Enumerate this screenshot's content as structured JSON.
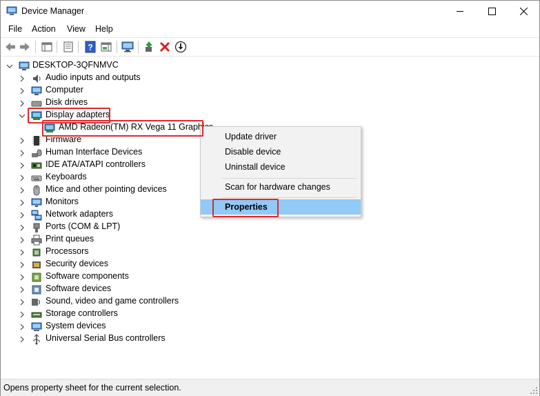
{
  "window": {
    "title": "Device Manager",
    "app_icon": "device-manager-icon",
    "controls": [
      "minimize-icon",
      "maximize-icon",
      "close-icon"
    ]
  },
  "menu": {
    "file": "File",
    "action": "Action",
    "view": "View",
    "help": "Help"
  },
  "toolbar": {
    "icons": [
      "back-icon",
      "forward-icon",
      "show-hide-console-tree-icon",
      "properties-icon",
      "help-icon",
      "action-pane-icon",
      "scan-hardware-icon",
      "update-driver-icon",
      "uninstall-icon",
      "disable-device-icon"
    ]
  },
  "tree": {
    "root": "DESKTOP-3QFNMVC",
    "items": [
      {
        "label": "Audio inputs and outputs",
        "icon": "speaker-icon"
      },
      {
        "label": "Computer",
        "icon": "computer-icon"
      },
      {
        "label": "Disk drives",
        "icon": "disk-drive-icon"
      },
      {
        "label": "Display adapters",
        "icon": "display-adapter-icon",
        "expanded": true,
        "children": [
          {
            "label": "AMD Radeon(TM) RX Vega 11 Graphics",
            "icon": "display-adapter-icon"
          }
        ]
      },
      {
        "label": "Firmware",
        "icon": "firmware-icon"
      },
      {
        "label": "Human Interface Devices",
        "icon": "hid-icon"
      },
      {
        "label": "IDE ATA/ATAPI controllers",
        "icon": "ide-controller-icon"
      },
      {
        "label": "Keyboards",
        "icon": "keyboard-icon"
      },
      {
        "label": "Mice and other pointing devices",
        "icon": "mouse-icon"
      },
      {
        "label": "Monitors",
        "icon": "monitor-icon"
      },
      {
        "label": "Network adapters",
        "icon": "network-adapter-icon"
      },
      {
        "label": "Ports (COM & LPT)",
        "icon": "port-icon"
      },
      {
        "label": "Print queues",
        "icon": "printer-icon"
      },
      {
        "label": "Processors",
        "icon": "processor-icon"
      },
      {
        "label": "Security devices",
        "icon": "security-device-icon"
      },
      {
        "label": "Software components",
        "icon": "software-component-icon"
      },
      {
        "label": "Software devices",
        "icon": "software-device-icon"
      },
      {
        "label": "Sound, video and game controllers",
        "icon": "sound-controller-icon"
      },
      {
        "label": "Storage controllers",
        "icon": "storage-controller-icon"
      },
      {
        "label": "System devices",
        "icon": "system-device-icon"
      },
      {
        "label": "Universal Serial Bus controllers",
        "icon": "usb-icon"
      }
    ]
  },
  "context_menu": {
    "update_driver": "Update driver",
    "disable_device": "Disable device",
    "uninstall_device": "Uninstall device",
    "scan": "Scan for hardware changes",
    "properties": "Properties"
  },
  "status": "Opens property sheet for the current selection.",
  "colors": {
    "highlight": "#91c9f7",
    "annotation_red": "#e4262b",
    "status_bar": "#f0f0f0",
    "context_menu_bg": "#f2f2f2"
  }
}
